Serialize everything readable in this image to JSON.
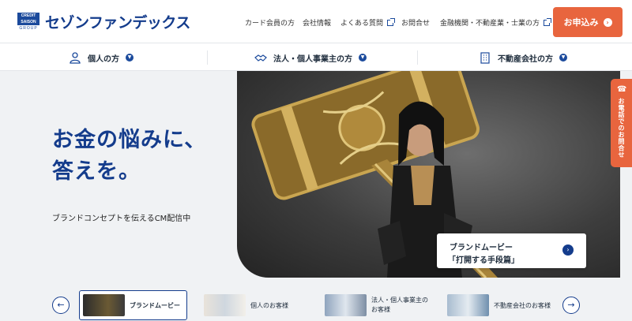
{
  "header": {
    "logo_top": "CREDIT SAISON",
    "logo_bottom": "GROUP",
    "brand": "セゾンファンデックス",
    "nav": [
      {
        "label": "カード会員の方"
      },
      {
        "label": "会社情報"
      },
      {
        "label": "よくある質問",
        "icon": "external-link-icon"
      },
      {
        "label": "お問合せ"
      },
      {
        "label": "金融機関・不動産業・士業の方",
        "icon": "external-link-icon"
      }
    ],
    "apply_label": "お申込み"
  },
  "categories": [
    {
      "label": "個人の方",
      "icon": "person-icon"
    },
    {
      "label": "法人・個人事業主の方",
      "icon": "handshake-icon"
    },
    {
      "label": "不動産会社の方",
      "icon": "building-icon"
    }
  ],
  "hero": {
    "title_line1": "お金の悩みに、",
    "title_line2": "答えを。",
    "subtitle": "ブランドコンセプトを伝えるCM配信中",
    "card_line1": "ブランドムービー",
    "card_line2": "「打開する手段篇」"
  },
  "side_tab": {
    "label": "お電話でのお問合せ",
    "icon": "phone-icon"
  },
  "carousel": {
    "items": [
      {
        "label": "ブランドムービー",
        "active": true
      },
      {
        "label": "個人のお客様"
      },
      {
        "label_line1": "法人・個人事業主の",
        "label_line2": "お客様"
      },
      {
        "label": "不動産会社のお客様"
      }
    ]
  },
  "colors": {
    "brand_blue": "#143c8c",
    "accent_orange": "#e8653e",
    "hero_bg": "#f0f2f4"
  }
}
